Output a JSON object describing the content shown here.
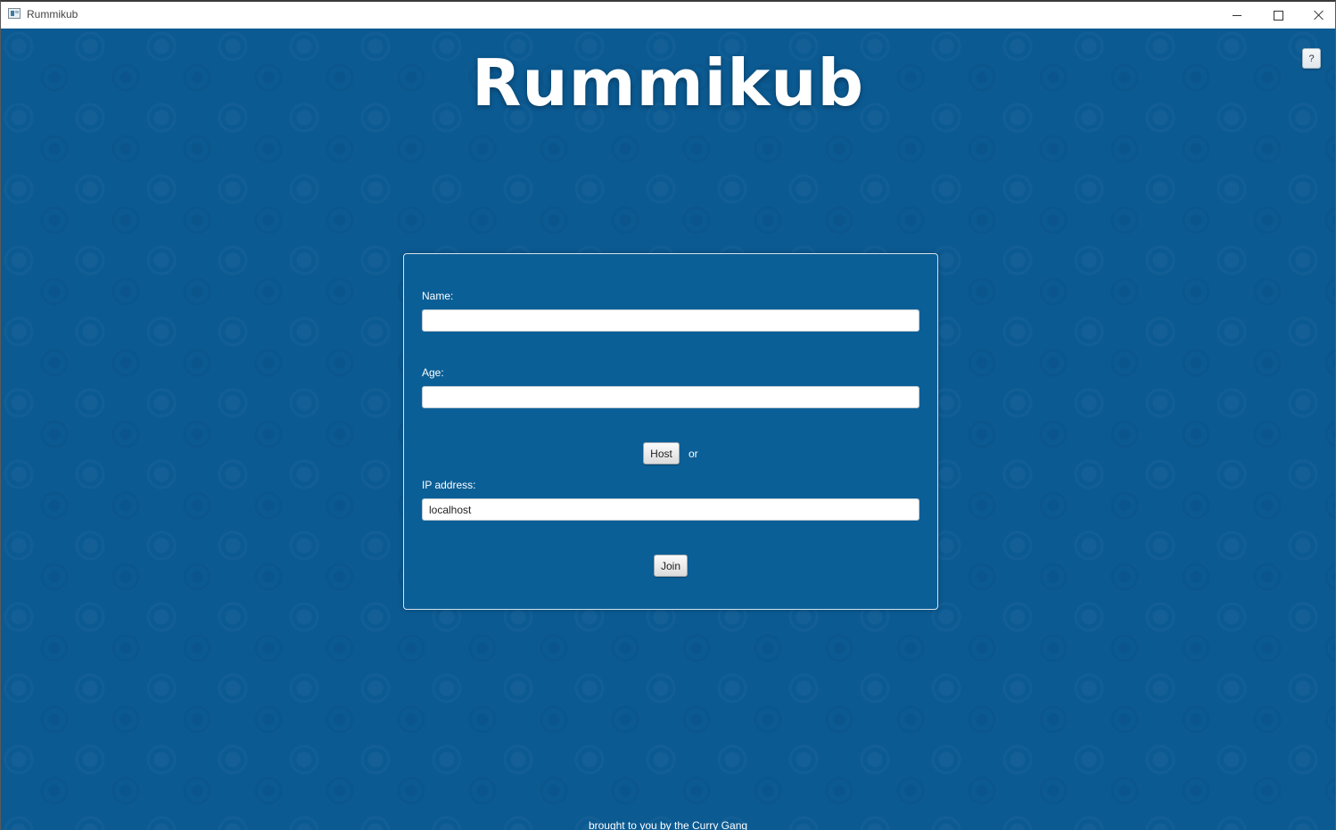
{
  "window": {
    "title": "Rummikub",
    "minimize_icon": "minimize-icon",
    "maximize_icon": "maximize-icon",
    "close_icon": "close-icon"
  },
  "header": {
    "title": "Rummikub",
    "help_label": "?"
  },
  "form": {
    "name_label": "Name:",
    "name_value": "",
    "age_label": "Age:",
    "age_value": "",
    "host_button": "Host",
    "or_text": "or",
    "ip_label": "IP address:",
    "ip_value": "localhost",
    "join_button": "Join"
  },
  "footer": {
    "credit": "brought to you by the Curry Gang"
  },
  "colors": {
    "background": "#0b5a92",
    "panel": "#0b5f97",
    "text": "#ffffff"
  }
}
